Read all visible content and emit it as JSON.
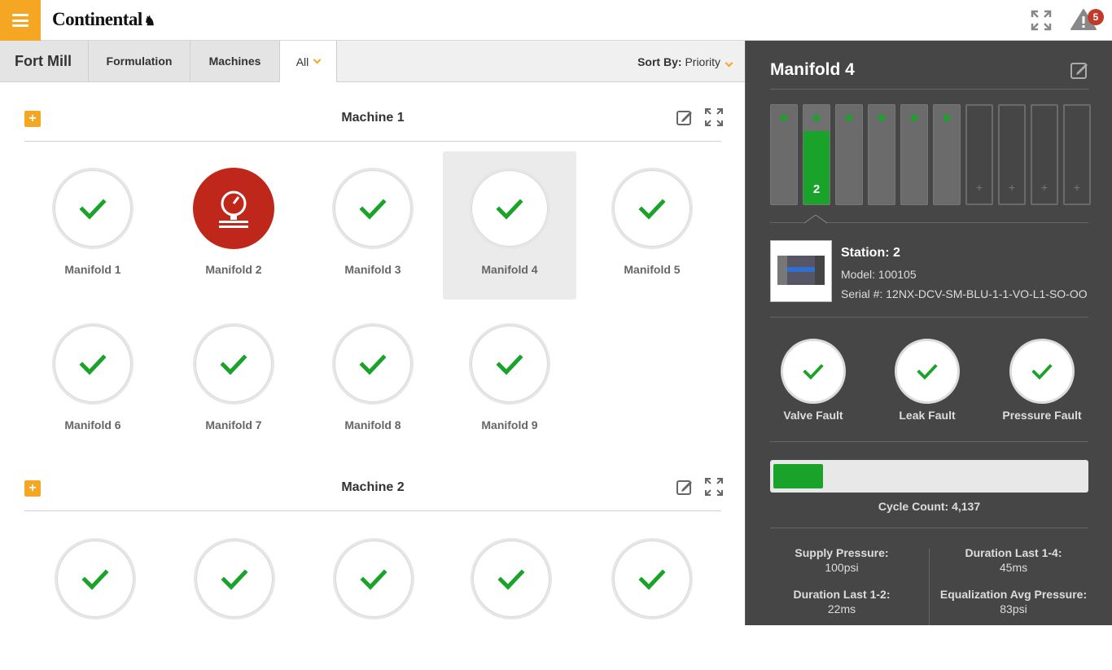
{
  "brand": {
    "logo_text": "Continental",
    "accent": "#f5a623",
    "ok_color": "#1aa32a",
    "alarm_color": "#c0271b"
  },
  "header": {
    "alert_count": "5"
  },
  "tabs": {
    "site": "Fort Mill",
    "formulation": "Formulation",
    "machines": "Machines",
    "filter": "All",
    "sort_label": "Sort By:",
    "sort_value": "Priority"
  },
  "machines": [
    {
      "title": "Machine 1",
      "manifolds": [
        {
          "label": "Manifold 1",
          "status": "ok"
        },
        {
          "label": "Manifold 2",
          "status": "alarm"
        },
        {
          "label": "Manifold 3",
          "status": "ok"
        },
        {
          "label": "Manifold 4",
          "status": "ok",
          "selected": true
        },
        {
          "label": "Manifold 5",
          "status": "ok"
        },
        {
          "label": "Manifold 6",
          "status": "ok"
        },
        {
          "label": "Manifold 7",
          "status": "ok"
        },
        {
          "label": "Manifold 8",
          "status": "ok"
        },
        {
          "label": "Manifold 9",
          "status": "ok"
        }
      ]
    },
    {
      "title": "Machine 2",
      "manifolds": [
        {
          "status": "ok"
        },
        {
          "status": "ok"
        },
        {
          "status": "ok"
        },
        {
          "status": "ok"
        },
        {
          "status": "ok"
        }
      ]
    }
  ],
  "detail": {
    "title": "Manifold 4",
    "stations": [
      {
        "filled": true
      },
      {
        "filled": true,
        "active": true,
        "number": "2"
      },
      {
        "filled": true
      },
      {
        "filled": true
      },
      {
        "filled": true
      },
      {
        "filled": true
      },
      {
        "filled": false,
        "plus": "+"
      },
      {
        "filled": false,
        "plus": "+"
      },
      {
        "filled": false,
        "plus": "+"
      },
      {
        "filled": false,
        "plus": "+"
      }
    ],
    "station": {
      "title": "Station: 2",
      "model": "Model: 100105",
      "serial": "Serial #: 12NX-DCV-SM-BLU-1-1-VO-L1-SO-OO"
    },
    "faults": [
      "Valve Fault",
      "Leak Fault",
      "Pressure Fault"
    ],
    "cycle": {
      "label": "Cycle Count: 4,137",
      "fill_fraction": 0.16
    },
    "stats": [
      {
        "key": "Supply Pressure:",
        "value": "100psi"
      },
      {
        "key": "Duration Last 1-4:",
        "value": "45ms"
      },
      {
        "key": "Duration Last 1-2:",
        "value": "22ms"
      },
      {
        "key": "Equalization Avg Pressure:",
        "value": "83psi"
      }
    ]
  }
}
